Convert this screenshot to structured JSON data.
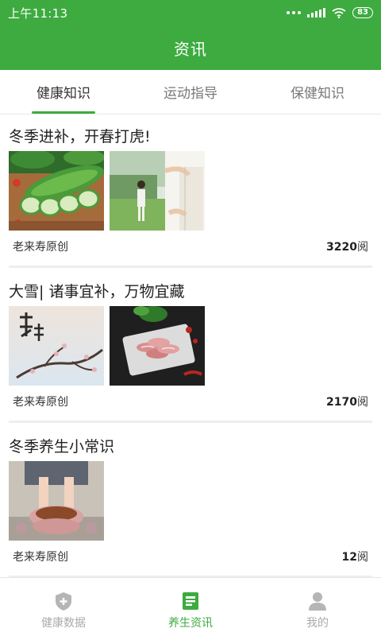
{
  "status_bar": {
    "time": "上午11:13",
    "battery": "83"
  },
  "app_title": "资讯",
  "tabs": [
    {
      "label": "健康知识",
      "active": true
    },
    {
      "label": "运动指导",
      "active": false
    },
    {
      "label": "保健知识",
      "active": false
    }
  ],
  "articles": [
    {
      "title": "冬季进补，开春打虎!",
      "source": "老来寿原创",
      "reads": "3220",
      "reads_unit": "阅",
      "images": [
        "bitter-melon",
        "tai-chi-exercise"
      ]
    },
    {
      "title": "大雪| 诸事宜补，万物宜藏",
      "source": "老来寿原创",
      "reads": "2170",
      "reads_unit": "阅",
      "images": [
        "snowy-plum-branch",
        "lamb-slices"
      ]
    },
    {
      "title": "冬季养生小常识",
      "source": "老来寿原创",
      "reads": "12",
      "reads_unit": "阅",
      "images": [
        "foot-soak"
      ]
    }
  ],
  "bottom_nav": [
    {
      "label": "健康数据",
      "icon": "shield-plus-icon",
      "active": false
    },
    {
      "label": "养生资讯",
      "icon": "news-icon",
      "active": true
    },
    {
      "label": "我的",
      "icon": "person-icon",
      "active": false
    }
  ],
  "colors": {
    "brand_green": "#3dab3f",
    "tab_inactive": "#777777",
    "nav_inactive": "#aaaaaa"
  }
}
